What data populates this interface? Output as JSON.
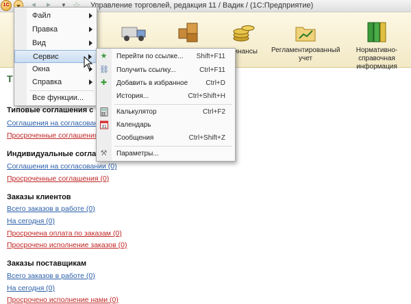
{
  "titlebar": {
    "app_badge": "1С",
    "title": "Управление торговлей, редакция 11 / Вадик /  (1С:Предприятие)",
    "back_glyph": "◄",
    "forward_glyph": "►",
    "dropdown_glyph": "▼",
    "star_glyph": "☆"
  },
  "toolbar": {
    "items": [
      {
        "label": "Финансы",
        "icon": "coins-icon"
      },
      {
        "label": "Регламентированный учет",
        "icon": "folder-chart-icon"
      },
      {
        "label": "Нормативно-справочная информация",
        "icon": "binders-icon"
      }
    ]
  },
  "main_menu": {
    "items": [
      {
        "label": "Файл",
        "has_submenu": true
      },
      {
        "label": "Правка",
        "has_submenu": true
      },
      {
        "label": "Вид",
        "has_submenu": true
      },
      {
        "label": "Сервис",
        "has_submenu": true,
        "highlighted": true
      },
      {
        "label": "Окна",
        "has_submenu": true
      },
      {
        "label": "Справка",
        "has_submenu": true
      },
      {
        "label": "Все функции...",
        "has_submenu": false
      }
    ]
  },
  "service_menu": {
    "items": [
      {
        "label": "Перейти по ссылке...",
        "shortcut": "Shift+F11",
        "icon": "star-arrow-icon"
      },
      {
        "label": "Получить ссылку...",
        "shortcut": "Ctrl+F11",
        "icon": "link-icon"
      },
      {
        "label": "Добавить в избранное",
        "shortcut": "Ctrl+D",
        "icon": "star-add-icon"
      },
      {
        "label": "История...",
        "shortcut": "Ctrl+Shift+H",
        "icon": "history-icon"
      },
      {
        "label": "Калькулятор",
        "shortcut": "Ctrl+F2",
        "icon": "calculator-icon"
      },
      {
        "label": "Календарь",
        "shortcut": "",
        "icon": "calendar-icon"
      },
      {
        "label": "Сообщения",
        "shortcut": "Ctrl+Shift+Z",
        "icon": "messages-icon"
      },
      {
        "label": "Параметры...",
        "shortcut": "",
        "icon": "settings-icon"
      }
    ]
  },
  "content": {
    "title_initial": "Т",
    "sections": [
      {
        "title": "Типовые соглашения с кл",
        "links": [
          {
            "text": "Соглашения на согласовании (",
            "tone": "blue"
          },
          {
            "text": "Просроченные соглашения (0)",
            "tone": "red"
          }
        ]
      },
      {
        "title": "Индивидуальные соглаше",
        "links": [
          {
            "text": "Соглашения на согласовании (0)",
            "tone": "blue"
          },
          {
            "text": "Просроченные соглашения (0)",
            "tone": "red"
          }
        ]
      },
      {
        "title": "Заказы клиентов",
        "links": [
          {
            "text": "Всего заказов в работе (0)",
            "tone": "blue"
          },
          {
            "text": "На сегодня (0)",
            "tone": "blue"
          },
          {
            "text": "Просрочена оплата по заказам (0)",
            "tone": "red"
          },
          {
            "text": "Просрочено исполнение заказов (0)",
            "tone": "red"
          }
        ]
      },
      {
        "title": "Заказы поставщикам",
        "links": [
          {
            "text": "Всего заказов в работе (0)",
            "tone": "blue"
          },
          {
            "text": "На сегодня (0)",
            "tone": "blue"
          },
          {
            "text": "Просрочено исполнение нами (0)",
            "tone": "red"
          }
        ]
      }
    ]
  },
  "colors": {
    "link_blue": "#2a5ea8",
    "link_red": "#c02424",
    "highlight": "#c9dcf2",
    "toolbar_bg": "#f3e9c6"
  }
}
